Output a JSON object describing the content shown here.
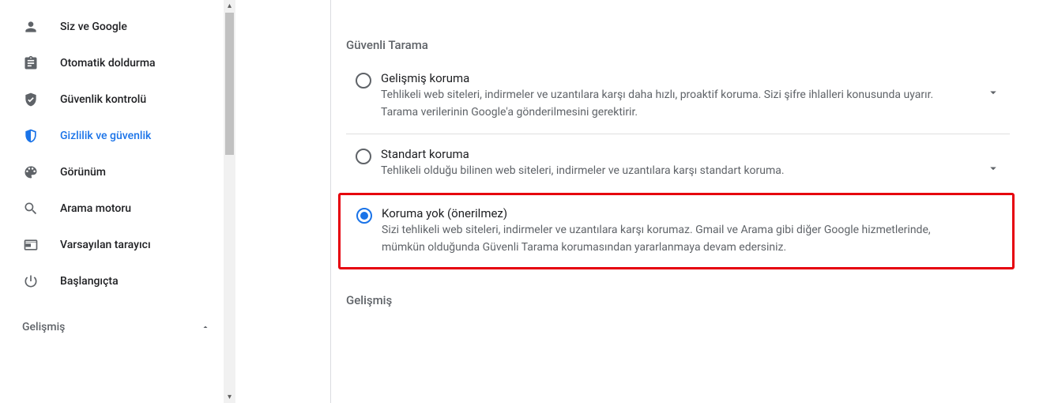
{
  "sidebar": {
    "items": [
      {
        "key": "you-google",
        "label": "Siz ve Google",
        "icon": "person-icon",
        "active": false
      },
      {
        "key": "autofill",
        "label": "Otomatik doldurma",
        "icon": "clipboard-icon",
        "active": false
      },
      {
        "key": "safety-check",
        "label": "Güvenlik kontrolü",
        "icon": "shield-check-icon",
        "active": false
      },
      {
        "key": "privacy-security",
        "label": "Gizlilik ve güvenlik",
        "icon": "shield-icon",
        "active": true
      },
      {
        "key": "appearance",
        "label": "Görünüm",
        "icon": "palette-icon",
        "active": false
      },
      {
        "key": "search-engine",
        "label": "Arama motoru",
        "icon": "search-icon",
        "active": false
      },
      {
        "key": "default-browser",
        "label": "Varsayılan tarayıcı",
        "icon": "browser-icon",
        "active": false
      },
      {
        "key": "on-startup",
        "label": "Başlangıçta",
        "icon": "power-icon",
        "active": false
      }
    ],
    "advanced": {
      "label": "Gelişmiş",
      "expanded": true
    }
  },
  "main": {
    "section_title": "Güvenli Tarama",
    "options": [
      {
        "key": "enhanced",
        "title": "Gelişmiş koruma",
        "desc": "Tehlikeli web siteleri, indirmeler ve uzantılara karşı daha hızlı, proaktif koruma. Sizi şifre ihlalleri konusunda uyarır. Tarama verilerinin Google'a gönderilmesini gerektirir.",
        "checked": false,
        "expandable": true
      },
      {
        "key": "standard",
        "title": "Standart koruma",
        "desc": "Tehlikeli olduğu bilinen web siteleri, indirmeler ve uzantılara karşı standart koruma.",
        "checked": false,
        "expandable": true
      },
      {
        "key": "none",
        "title": "Koruma yok (önerilmez)",
        "desc": "Sizi tehlikeli web siteleri, indirmeler ve uzantılara karşı korumaz. Gmail ve Arama gibi diğer Google hizmetlerinde, mümkün olduğunda Güvenli Tarama korumasından yararlanmaya devam edersiniz.",
        "checked": true,
        "expandable": false,
        "highlight": true
      }
    ],
    "advanced_title": "Gelişmiş"
  }
}
